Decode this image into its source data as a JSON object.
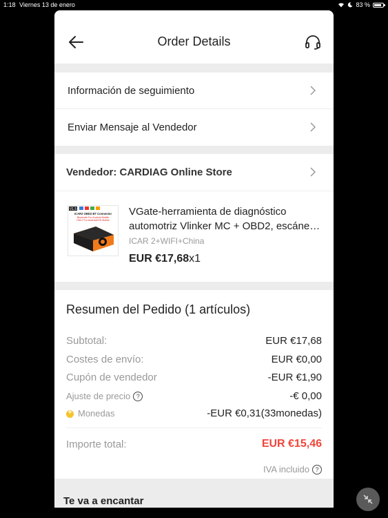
{
  "status": {
    "time": "1:18",
    "date": "Viernes 13 de enero",
    "battery": "83 %",
    "battery_level": 0.83
  },
  "header": {
    "title": "Order Details"
  },
  "links": {
    "tracking": "Información de seguimiento",
    "message_seller": "Enviar Mensaje al Vendedor"
  },
  "seller": {
    "label": "Vendedor: CARDIAG Online Store"
  },
  "product": {
    "title": "VGate-herramienta de diagnóstico automotriz Vlinker MC + OBD2, escáner de…",
    "variant": "ICAR 2+WIFI+China",
    "price": "EUR €17,68",
    "qty": "x1",
    "image_caption": "ICAR2 OBD2 BT Connector",
    "image_sub1": "Bluetooth For Android Mobile",
    "image_sub2": "ONLY For Android/IOS Mobile",
    "image_badge": "V1.5"
  },
  "summary": {
    "title": "Resumen del Pedido (1 artículos)",
    "subtotal_label": "Subtotal:",
    "subtotal_value": "EUR €17,68",
    "shipping_label": "Costes de envío:",
    "shipping_value": "EUR €0,00",
    "coupon_label": "Cupón de vendedor",
    "coupon_value": "-EUR €1,90",
    "adjust_label": "Ajuste de precio",
    "adjust_value": "-€ 0,00",
    "coins_label": "Monedas",
    "coins_value": "-EUR €0,31(33monedas)",
    "total_label": "Importe total:",
    "total_value": "EUR €15,46",
    "iva": "IVA incluido"
  },
  "recommend": {
    "title": "Te va a encantar"
  },
  "colors": {
    "accent": "#f0453a",
    "coin": "#f6c32a"
  }
}
